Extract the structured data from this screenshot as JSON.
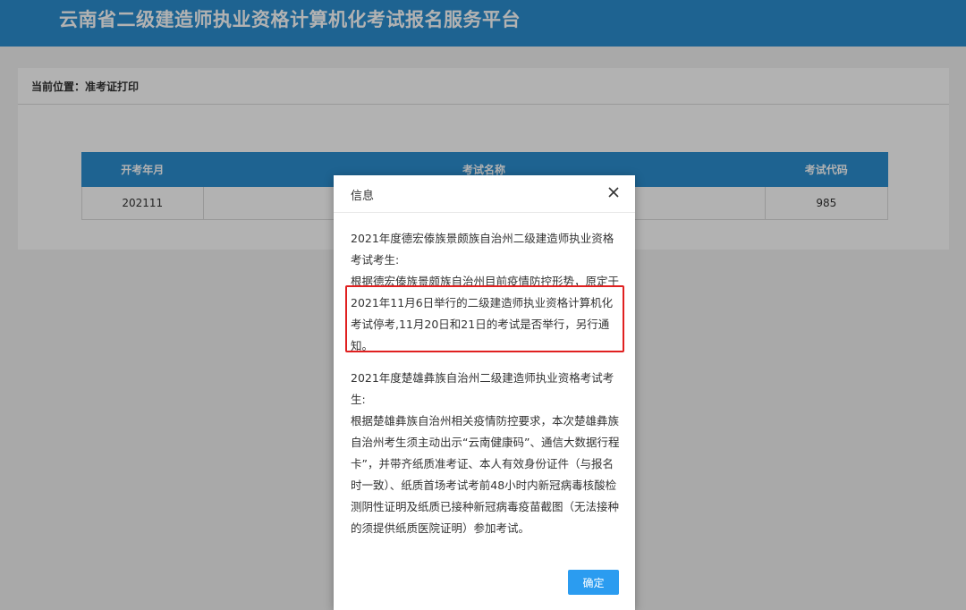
{
  "header": {
    "title": "云南省二级建造师执业资格计算机化考试报名服务平台"
  },
  "breadcrumb": {
    "text": "当前位置：准考证打印"
  },
  "table": {
    "headers": [
      "开考年月",
      "考试名称",
      "考试代码"
    ],
    "rows": [
      [
        "202111",
        "",
        "985"
      ]
    ]
  },
  "dialog": {
    "title": "信息",
    "paragraphs": [
      "2021年度德宏傣族景颇族自治州二级建造师执业资格考试考生:\n根据德宏傣族景颇族自治州目前疫情防控形势，原定于2021年11月6日举行的二级建造师执业资格计算机化考试停考,11月20日和21日的考试是否举行，另行通知。",
      "2021年度楚雄彝族自治州二级建造师执业资格考试考生:\n根据楚雄彝族自治州相关疫情防控要求，本次楚雄彝族自治州考生须主动出示“云南健康码”、通信大数据行程卡”，并带齐纸质准考证、本人有效身份证件（与报名时一致）、纸质首场考试考前48小时内新冠病毒核酸检测阴性证明及纸质已接种新冠病毒疫苗截图（无法接种的须提供纸质医院证明）参加考试。"
    ],
    "ok_label": "确定"
  },
  "icons": {
    "close": "close-icon"
  },
  "colors": {
    "header_bg": "#2b8ed0",
    "button_bg": "#2b9cf0",
    "highlight": "#e02020"
  }
}
